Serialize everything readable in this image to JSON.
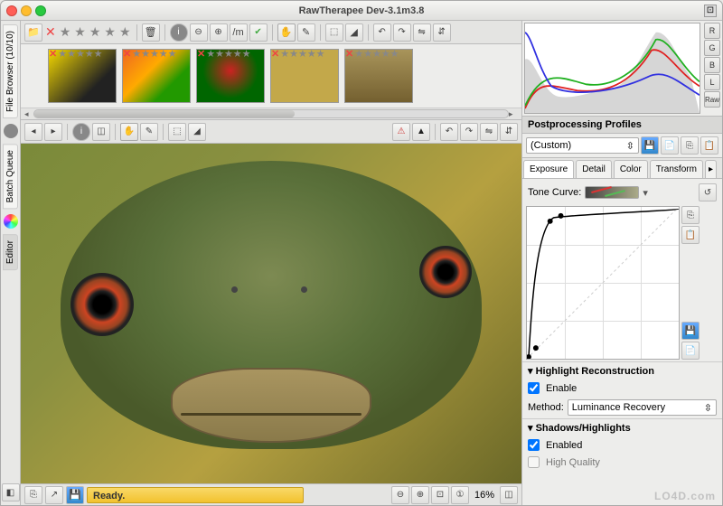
{
  "window": {
    "title": "RawTherapee Dev-3.1m3.8"
  },
  "sidebar": {
    "tabs": [
      {
        "label": "File Browser (10/10)"
      },
      {
        "label": "Batch Queue"
      },
      {
        "label": "Editor"
      }
    ]
  },
  "toolbar1": {
    "folder_icon": "folder",
    "trash_icon": "trash",
    "info_icon": "info",
    "expand_icon": "expand",
    "collapse_icon": "collapse",
    "ab_label": "/m",
    "checkmark": "check"
  },
  "thumbs": {
    "count": 5
  },
  "status": {
    "ready": "Ready.",
    "zoom": "16%"
  },
  "histogram": {
    "buttons": [
      "R",
      "G",
      "B",
      "L",
      "Raw"
    ]
  },
  "profiles": {
    "header": "Postprocessing Profiles",
    "current": "(Custom)"
  },
  "tabs": {
    "items": [
      "Exposure",
      "Detail",
      "Color",
      "Transform"
    ],
    "arrow": "▸"
  },
  "exposure": {
    "tonecurve_label": "Tone Curve:",
    "hl_header": "Highlight Reconstruction",
    "hl_enable": "Enable",
    "hl_method_label": "Method:",
    "hl_method_value": "Luminance Recovery",
    "sh_header": "Shadows/Highlights",
    "sh_enabled": "Enabled",
    "sh_hq": "High Quality"
  },
  "watermark": "LO4D.com",
  "chart_data": {
    "type": "line",
    "title": "RGB Histogram",
    "xlabel": "",
    "ylabel": "",
    "x_range": [
      0,
      255
    ],
    "series": [
      {
        "name": "R",
        "color": "#e02020"
      },
      {
        "name": "G",
        "color": "#20b020"
      },
      {
        "name": "B",
        "color": "#3030e0"
      },
      {
        "name": "L",
        "color": "#888888"
      }
    ]
  }
}
